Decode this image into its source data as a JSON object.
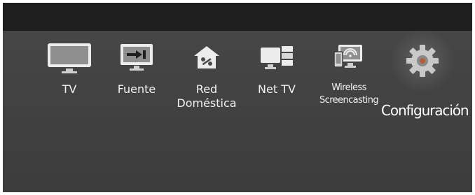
{
  "menu": {
    "selected_index": 5,
    "items": [
      {
        "id": "tv",
        "label": "TV",
        "icon": "tv-icon"
      },
      {
        "id": "fuente",
        "label": "Fuente",
        "icon": "source-icon"
      },
      {
        "id": "red",
        "label_line1": "Red",
        "label_line2": "Doméstica",
        "icon": "home-network-icon"
      },
      {
        "id": "nettv",
        "label": "Net TV",
        "icon": "net-tv-icon"
      },
      {
        "id": "wireless",
        "label_line1": "Wireless",
        "label_line2": "Screencasting",
        "icon": "wireless-screencasting-icon"
      },
      {
        "id": "config",
        "label": "Configuración",
        "icon": "gear-icon"
      }
    ]
  },
  "colors": {
    "top_bar": "#1f1e1f",
    "background": "#3f3f3f",
    "text": "#f2f2f2"
  }
}
